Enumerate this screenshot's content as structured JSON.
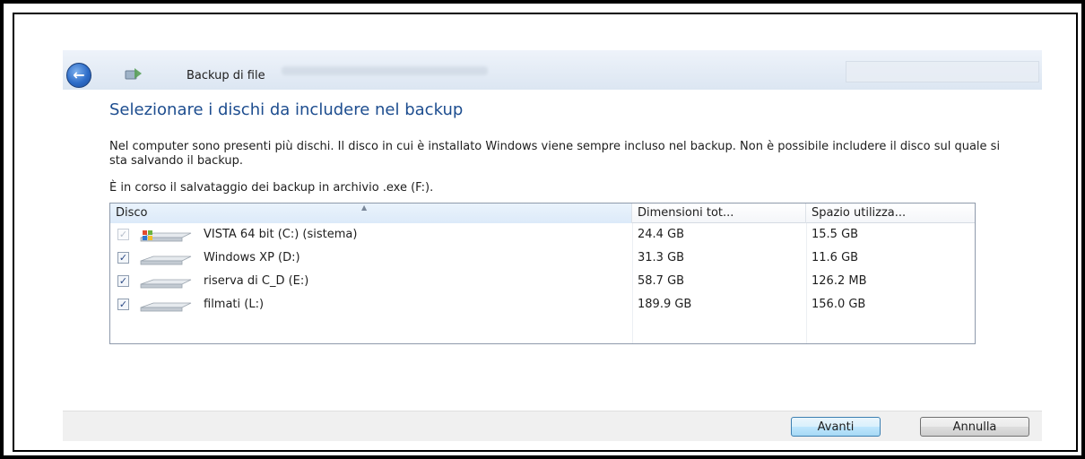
{
  "window": {
    "title": "Backup di file",
    "heading": "Selezionare i dischi da includere nel backup",
    "description": "Nel computer sono presenti più dischi. Il disco in cui è installato Windows viene sempre incluso nel backup. Non è possibile includere il disco sul quale si sta salvando il backup.",
    "info": "È in corso il salvataggio dei backup in archivio .exe (F:)."
  },
  "list": {
    "columns": [
      "Disco",
      "Dimensioni tot...",
      "Spazio utilizza..."
    ],
    "rows": [
      {
        "name": "VISTA 64 bit (C:) (sistema)",
        "size": "24.4 GB",
        "used": "15.5 GB",
        "checked": true,
        "disabled": true,
        "icon": "windows-drive-icon"
      },
      {
        "name": "Windows XP (D:)",
        "size": "31.3 GB",
        "used": "11.6 GB",
        "checked": true,
        "disabled": false,
        "icon": "drive-icon"
      },
      {
        "name": "riserva di C_D (E:)",
        "size": "58.7 GB",
        "used": "126.2 MB",
        "checked": true,
        "disabled": false,
        "icon": "drive-icon"
      },
      {
        "name": "filmati (L:)",
        "size": "189.9 GB",
        "used": "156.0 GB",
        "checked": true,
        "disabled": false,
        "icon": "drive-icon"
      }
    ]
  },
  "buttons": {
    "next": "Avanti",
    "cancel": "Annulla"
  },
  "colors": {
    "heading": "#1d4d8f",
    "primary_button_border": "#3c7fb1"
  }
}
